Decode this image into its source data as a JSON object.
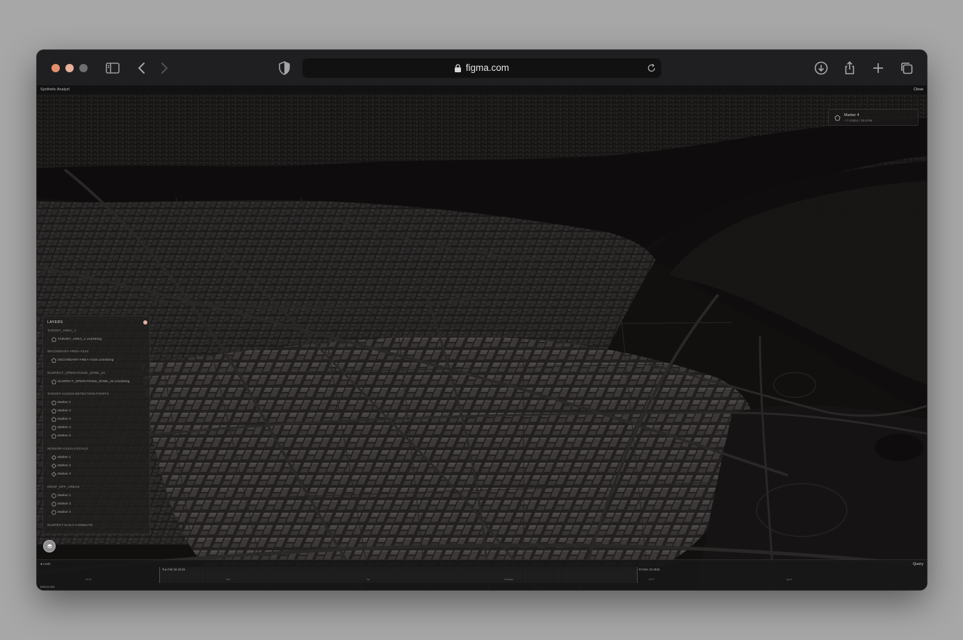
{
  "browser": {
    "url": "figma.com",
    "traffic_lights": [
      "close",
      "minimize",
      "zoom"
    ],
    "icons": [
      "sidebar-icon",
      "back-icon",
      "forward-icon",
      "shield-icon",
      "lock-icon",
      "reload-icon",
      "download-icon",
      "share-icon",
      "new-tab-icon",
      "tabs-overview-icon"
    ]
  },
  "app": {
    "title": "Synthetic Analyst",
    "close_label": "Close"
  },
  "marker_card": {
    "title": "Marker 4",
    "coords": "-77.03854 / 38.8798"
  },
  "layers": {
    "heading": "LAYERS",
    "groups": [
      {
        "name": "TARGET_AREA_1",
        "items": [
          {
            "label": "TARGET_AREA_1 LineString",
            "icon": "pentagon-icon"
          }
        ]
      },
      {
        "name": "SECONDARY-AREA-A234",
        "items": [
          {
            "label": "SECONDARY-AREA-A234 LineString",
            "icon": "pentagon-icon"
          }
        ]
      },
      {
        "name": "SUSPECT_OPERATIONS_ZONE_24",
        "items": [
          {
            "label": "SUSPECT_OPERATIONS_ZONE_24 LineString",
            "icon": "pentagon-icon"
          }
        ]
      },
      {
        "name": "TARGET-A23423-DETECTION-POINTS",
        "items": [
          {
            "label": "Marker 1",
            "icon": "pentagon-icon"
          },
          {
            "label": "Marker 2",
            "icon": "pentagon-icon"
          },
          {
            "label": "Marker 3",
            "icon": "pentagon-icon"
          },
          {
            "label": "Marker 4",
            "icon": "pentagon-icon"
          },
          {
            "label": "Marker 5",
            "icon": "pentagon-icon"
          }
        ]
      },
      {
        "name": "SENSOR-A234V-LOCALS",
        "items": [
          {
            "label": "Marker 1",
            "icon": "diamond-icon"
          },
          {
            "label": "Marker 2",
            "icon": "diamond-icon"
          },
          {
            "label": "Marker 3",
            "icon": "diamond-icon"
          }
        ]
      },
      {
        "name": "DROP_OFF_AREAS",
        "items": [
          {
            "label": "Marker 1",
            "icon": "circle-icon"
          },
          {
            "label": "Marker 2",
            "icon": "circle-icon"
          },
          {
            "label": "Marker 3",
            "icon": "circle-icon"
          }
        ]
      },
      {
        "name": "SUSPECT-DAILY-COMMUTE",
        "items": []
      }
    ]
  },
  "timeline": {
    "live_label": "● LIVE",
    "query_label": "Query",
    "bottom_label": "Bottom Bar",
    "range_start": "Tue Feb 16 19:26",
    "range_end": "Fri Dec 23 2016",
    "ticks": [
      "2016",
      "Feb",
      "Jul",
      "October",
      "2017",
      "April"
    ]
  },
  "colors": {
    "map_background": "#141212",
    "building": "#4a4747",
    "road": "#3a3737",
    "water": "#0f0e0e",
    "accent": "#e4b39b"
  }
}
